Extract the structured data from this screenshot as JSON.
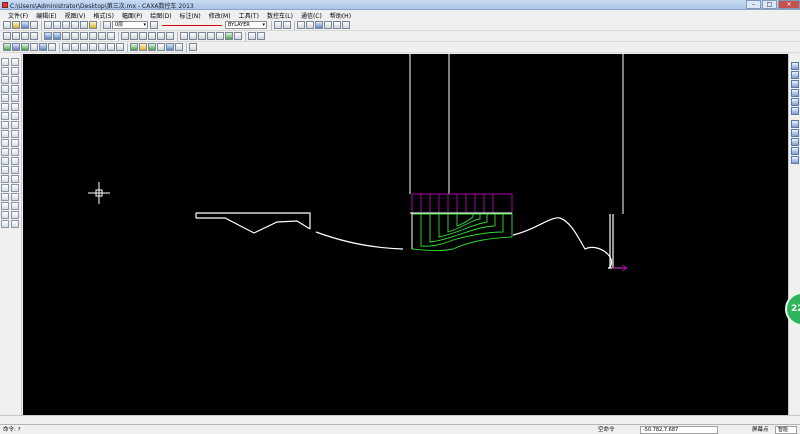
{
  "window": {
    "title": "C:\\Users\\Administrator\\Desktop\\第三次.mx - CAXA数控车 2013"
  },
  "menu": [
    "文件(F)",
    "编辑(E)",
    "视图(V)",
    "格式(S)",
    "幅面(P)",
    "绘图(D)",
    "标注(N)",
    "修改(M)",
    "工具(T)",
    "数控车(L)",
    "通信(C)",
    "帮助(H)"
  ],
  "toolbar": {
    "layer_value": "0层",
    "linetype_value": "BYLAYER"
  },
  "badge": {
    "text": "22"
  },
  "status": {
    "command_prompt": "命令: ?",
    "mode": "空命令",
    "coordinates": "-50.782,7.687",
    "snap_mode": "屏幕点",
    "snap_option": "智能"
  },
  "colors": {
    "canvas_bg": "#000000",
    "outline": "#ffffff",
    "toolpath_green": "#33dd33",
    "blank_magenta": "#aa00aa"
  }
}
